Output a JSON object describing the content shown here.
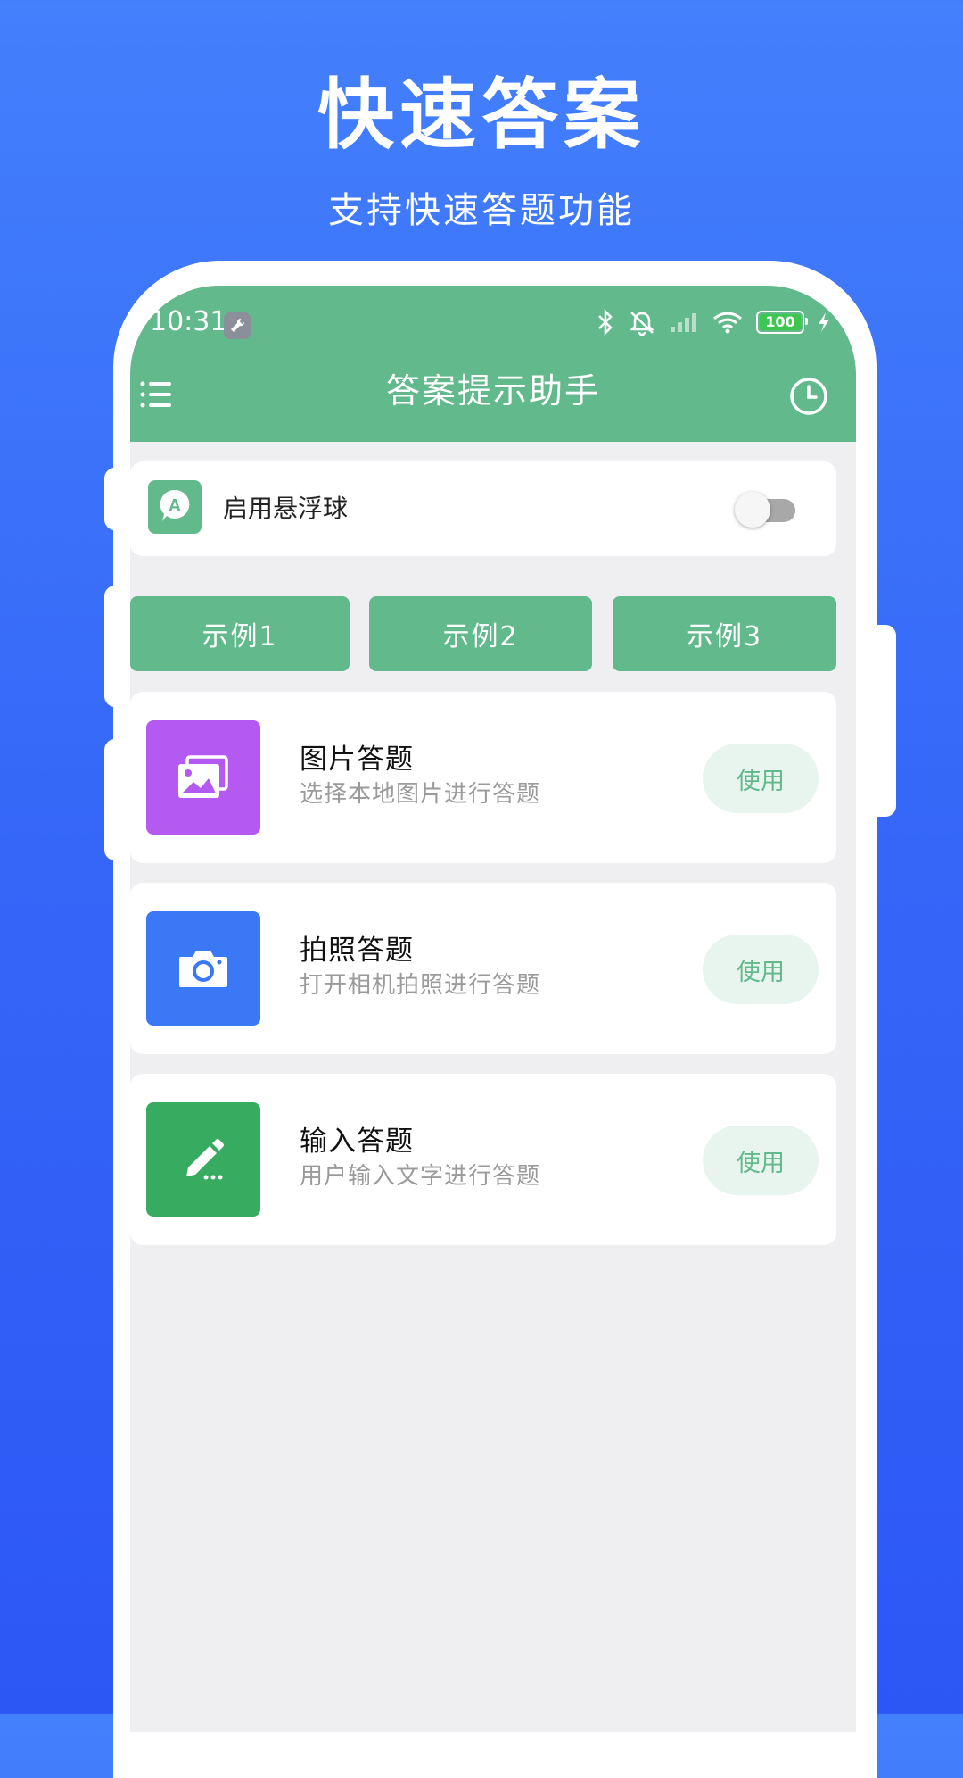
{
  "promo": {
    "title": "快速答案",
    "subtitle": "支持快速答题功能"
  },
  "status_bar": {
    "time": "10:31",
    "battery": "100",
    "icons": [
      "wrench-icon",
      "bluetooth-icon",
      "mute-icon",
      "signal-icon",
      "wifi-icon",
      "battery-icon",
      "charging-icon"
    ]
  },
  "app_bar": {
    "title": "答案提示助手",
    "menu_icon": "menu-icon",
    "history_icon": "clock-icon"
  },
  "floating_ball": {
    "label": "启用悬浮球",
    "enabled": false,
    "logo_letter": "A"
  },
  "examples": [
    "示例1",
    "示例2",
    "示例3"
  ],
  "features": [
    {
      "title": "图片答题",
      "desc": "选择本地图片进行答题",
      "button": "使用",
      "icon": "image-icon",
      "color": "#b45af2"
    },
    {
      "title": "拍照答题",
      "desc": "打开相机拍照进行答题",
      "button": "使用",
      "icon": "camera-icon",
      "color": "#3b78f6"
    },
    {
      "title": "输入答题",
      "desc": "用户输入文字进行答题",
      "button": "使用",
      "icon": "pencil-icon",
      "color": "#37ab5f"
    }
  ],
  "colors": {
    "accent": "#62b98b",
    "background_top": "#4380fc",
    "background_bottom": "#2d57f5",
    "screen_bg": "#efeff1"
  }
}
